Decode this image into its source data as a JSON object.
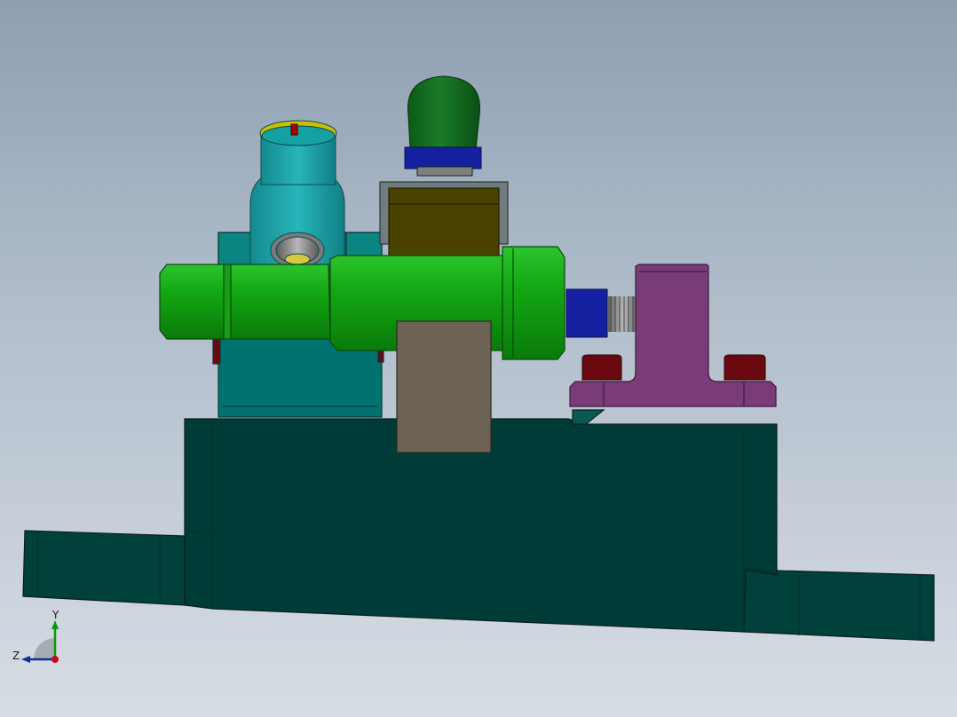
{
  "viewport": {
    "background_top": "#8e9fb2",
    "background_bottom": "#d7dde4"
  },
  "model": {
    "colors": {
      "base": "#003f3a",
      "base_edge": "#0b1e1c",
      "teal_bracket": "#00726f",
      "cyan_cylinder": "#1aa3a8",
      "yellow_ring": "#c8c000",
      "green_shaft": "#0fa010",
      "dark_green_knob": "#116b1d",
      "blue_nut": "#1420a0",
      "olive_block": "#4a4300",
      "gray_plate": "#6c6356",
      "purple_support": "#7a3c78",
      "maroon_bolt": "#6a0a10",
      "thread_gray": "#9a9a9a"
    }
  },
  "triad": {
    "y_label": "Y",
    "z_label": "Z",
    "y_color": "#0a9a0a",
    "z_color": "#1a2aa0",
    "x_color": "#c01010"
  }
}
